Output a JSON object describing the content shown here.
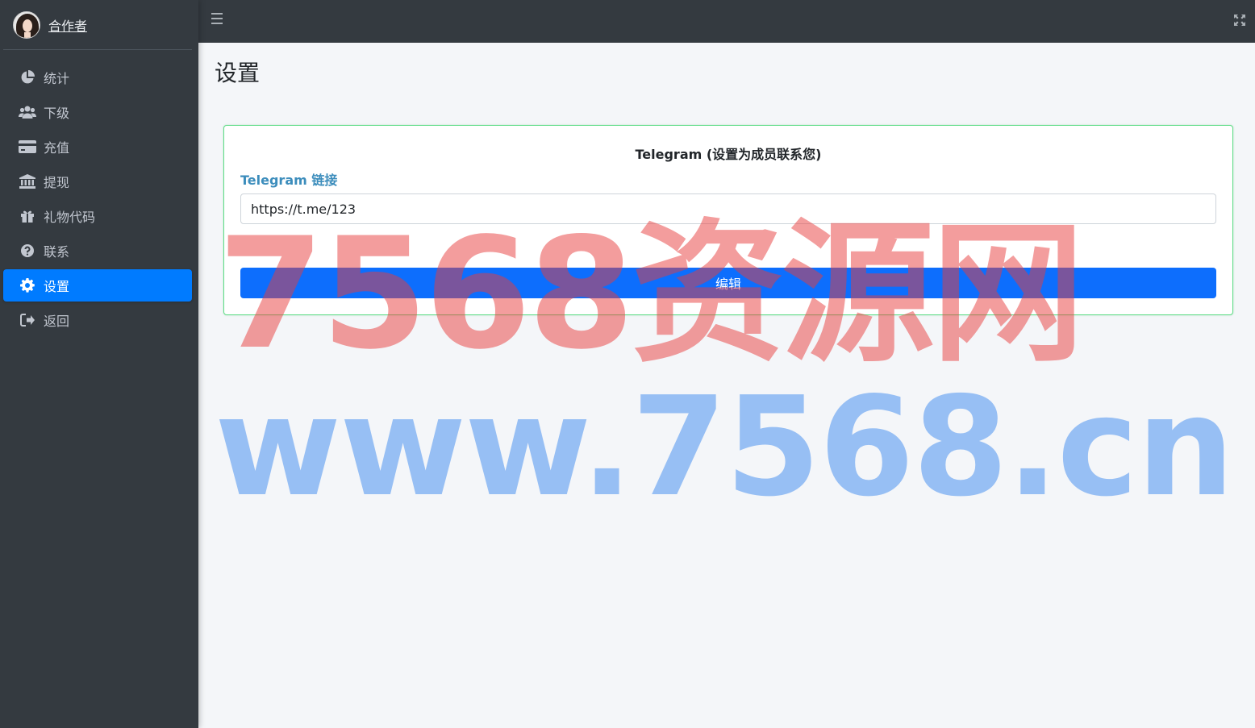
{
  "sidebar": {
    "brand_name": "合作者",
    "items": [
      {
        "label": "统计",
        "icon": "pie-chart-icon"
      },
      {
        "label": "下级",
        "icon": "users-icon"
      },
      {
        "label": "充值",
        "icon": "credit-card-icon"
      },
      {
        "label": "提现",
        "icon": "bank-icon"
      },
      {
        "label": "礼物代码",
        "icon": "gift-icon"
      },
      {
        "label": "联系",
        "icon": "question-circle-icon"
      },
      {
        "label": "设置",
        "icon": "gear-icon",
        "active": true
      },
      {
        "label": "返回",
        "icon": "sign-out-icon"
      }
    ]
  },
  "topbar": {
    "menu_icon": "hamburger-icon",
    "fullscreen_icon": "expand-icon"
  },
  "main": {
    "title": "设置",
    "card": {
      "heading": "Telegram (设置为成员联系您)",
      "field_label": "Telegram 链接",
      "field_value": "https://t.me/123",
      "submit_label": "编辑"
    }
  },
  "watermark": {
    "line1": "7568资源网",
    "line2": "www.7568.cn"
  },
  "colors": {
    "sidebar_bg": "#343a40",
    "active_item": "#007bff",
    "button": "#0d6efd",
    "label": "#3c8dbc",
    "card_border": "#5ddc86"
  }
}
